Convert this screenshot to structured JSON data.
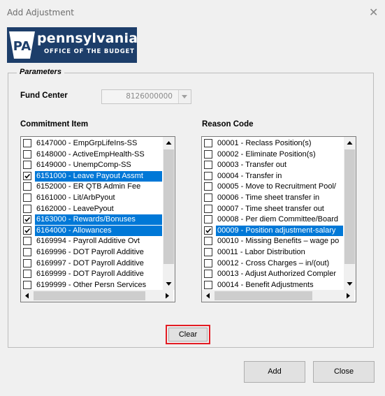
{
  "window": {
    "title": "Add Adjustment",
    "close_glyph": "✕"
  },
  "logo": {
    "initials": "PA",
    "name": "pennsylvania",
    "subtitle": "OFFICE OF THE BUDGET",
    "color": "#1d3e6a"
  },
  "parameters": {
    "legend": "Parameters",
    "fund_center": {
      "label": "Fund Center",
      "value": "8126000000"
    },
    "commitment_item": {
      "label": "Commitment Item",
      "items": [
        {
          "label": "6147000 - EmpGrpLifeIns-SS",
          "checked": false,
          "selected": false
        },
        {
          "label": "6148000 - ActiveEmpHealth-SS",
          "checked": false,
          "selected": false
        },
        {
          "label": "6149000 - UnempComp-SS",
          "checked": false,
          "selected": false
        },
        {
          "label": "6151000 - Leave Payout Assmt",
          "checked": true,
          "selected": true
        },
        {
          "label": "6152000 - ER QTB Admin Fee",
          "checked": false,
          "selected": false
        },
        {
          "label": "6161000 - Lit/ArbPyout",
          "checked": false,
          "selected": false
        },
        {
          "label": "6162000 - LeavePyout",
          "checked": false,
          "selected": false
        },
        {
          "label": "6163000 - Rewards/Bonuses",
          "checked": true,
          "selected": true
        },
        {
          "label": "6164000 - Allowances",
          "checked": true,
          "selected": true
        },
        {
          "label": "6169994 - Payroll Additive Ovt",
          "checked": false,
          "selected": false
        },
        {
          "label": "6169996 - DOT Payroll Additive",
          "checked": false,
          "selected": false
        },
        {
          "label": "6169997 - DOT Payroll Additive",
          "checked": false,
          "selected": false
        },
        {
          "label": "6169999 - DOT Payroll Additive",
          "checked": false,
          "selected": false
        },
        {
          "label": "6199999 - Other Persn Services",
          "checked": false,
          "selected": false
        }
      ]
    },
    "reason_code": {
      "label": "Reason Code",
      "items": [
        {
          "label": "00001 - Reclass Position(s)",
          "checked": false,
          "selected": false
        },
        {
          "label": "00002 - Eliminate Position(s)",
          "checked": false,
          "selected": false
        },
        {
          "label": "00003 - Transfer out",
          "checked": false,
          "selected": false
        },
        {
          "label": "00004 - Transfer in",
          "checked": false,
          "selected": false
        },
        {
          "label": "00005 - Move to Recruitment Pool/",
          "checked": false,
          "selected": false
        },
        {
          "label": "00006 - Time sheet transfer in",
          "checked": false,
          "selected": false
        },
        {
          "label": "00007 - Time sheet transfer out",
          "checked": false,
          "selected": false
        },
        {
          "label": "00008 - Per diem Committee/Board",
          "checked": false,
          "selected": false
        },
        {
          "label": "00009 - Position adjustment-salary",
          "checked": true,
          "selected": true
        },
        {
          "label": "00010 - Missing Benefits – wage po",
          "checked": false,
          "selected": false
        },
        {
          "label": "00011 - Labor Distribution",
          "checked": false,
          "selected": false
        },
        {
          "label": "00012 - Cross Charges – in/(out)",
          "checked": false,
          "selected": false
        },
        {
          "label": "00013 - Adjust Authorized Compler",
          "checked": false,
          "selected": false
        },
        {
          "label": "00014 - Benefit Adjustments",
          "checked": false,
          "selected": false
        }
      ]
    },
    "clear_label": "Clear"
  },
  "footer": {
    "add_label": "Add",
    "close_label": "Close"
  },
  "colors": {
    "selection": "#0078d7",
    "highlight_outline": "#e31c23"
  }
}
